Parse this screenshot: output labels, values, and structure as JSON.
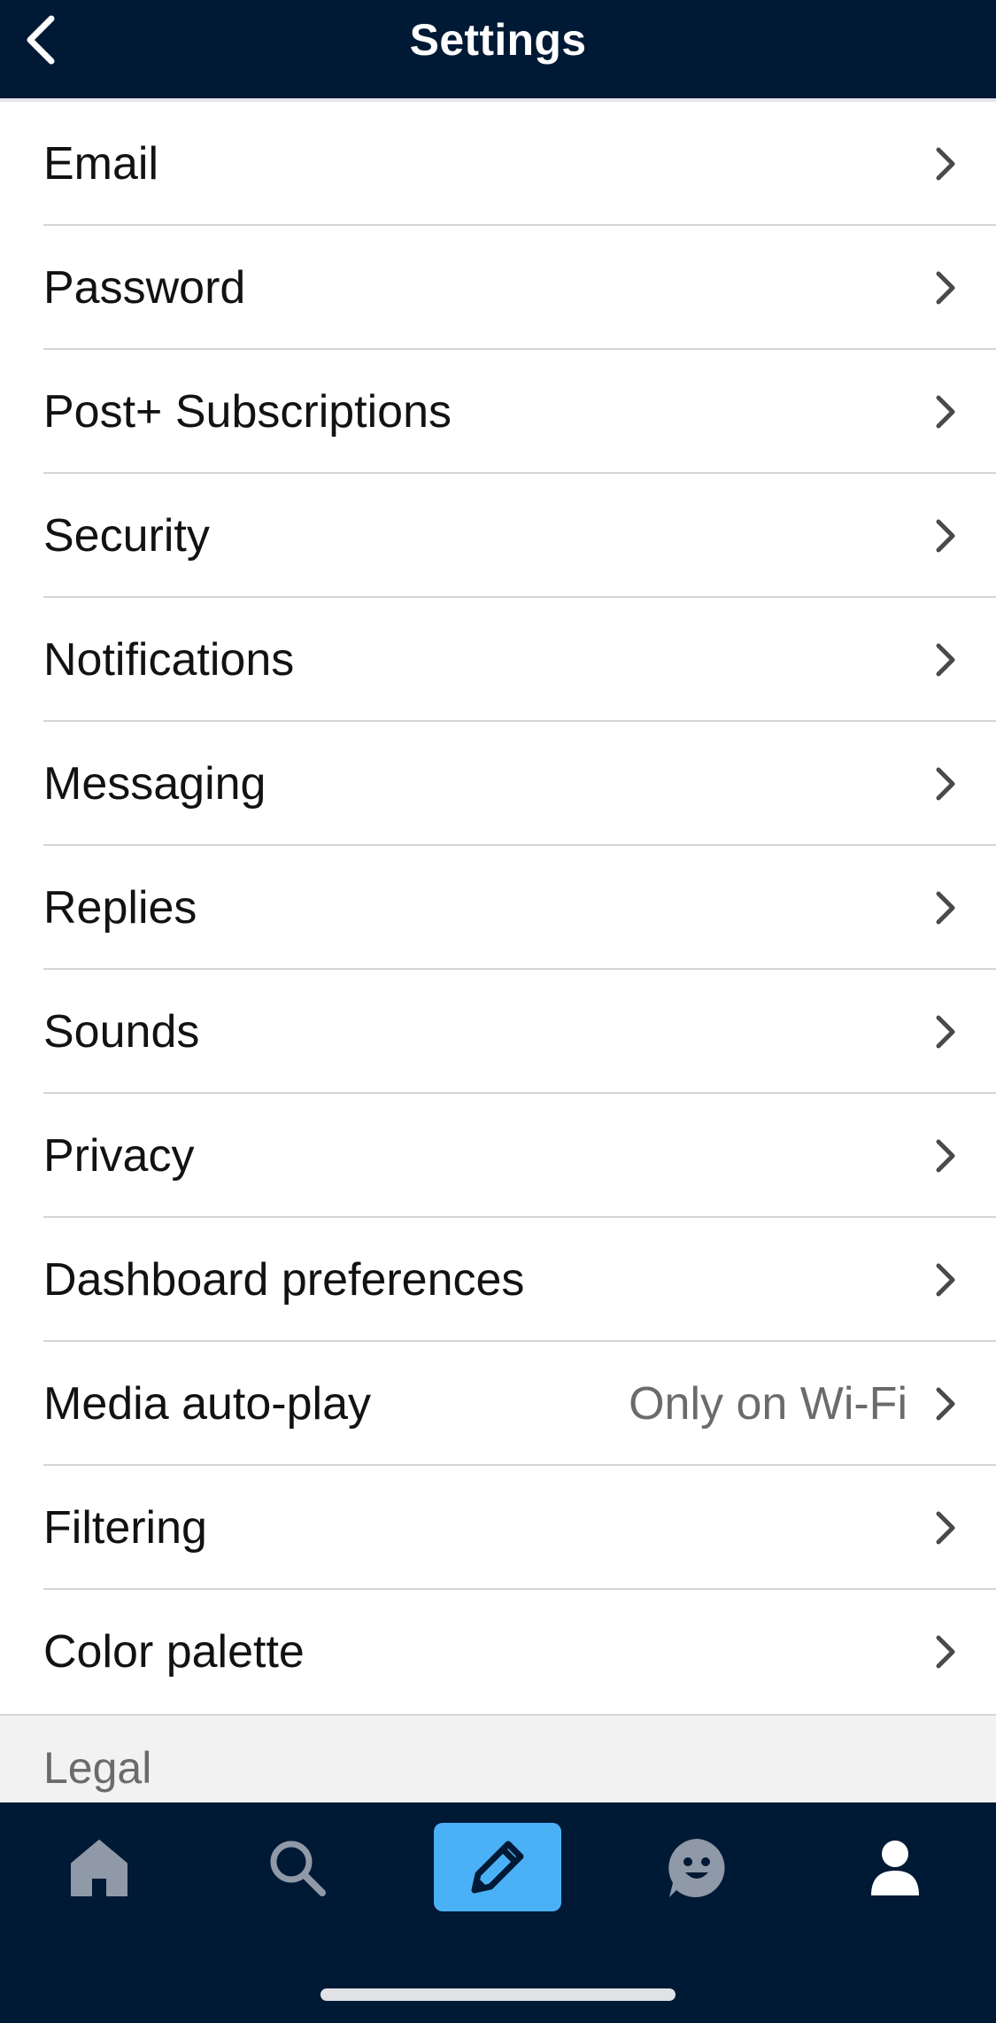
{
  "header": {
    "title": "Settings"
  },
  "settings_items": [
    {
      "label": "Email",
      "value": ""
    },
    {
      "label": "Password",
      "value": ""
    },
    {
      "label": "Post+ Subscriptions",
      "value": ""
    },
    {
      "label": "Security",
      "value": ""
    },
    {
      "label": "Notifications",
      "value": ""
    },
    {
      "label": "Messaging",
      "value": ""
    },
    {
      "label": "Replies",
      "value": ""
    },
    {
      "label": "Sounds",
      "value": ""
    },
    {
      "label": "Privacy",
      "value": ""
    },
    {
      "label": "Dashboard preferences",
      "value": ""
    },
    {
      "label": "Media auto-play",
      "value": "Only on Wi-Fi"
    },
    {
      "label": "Filtering",
      "value": ""
    },
    {
      "label": "Color palette",
      "value": ""
    }
  ],
  "section": {
    "label": "Legal"
  },
  "tab_bar": {
    "tabs": [
      {
        "icon": "home-icon"
      },
      {
        "icon": "search-icon"
      },
      {
        "icon": "pencil-icon"
      },
      {
        "icon": "smiley-icon"
      },
      {
        "icon": "person-icon"
      }
    ]
  },
  "colors": {
    "header_bg": "#001935",
    "compose_accent": "#4bb1f6",
    "text": "#121212",
    "secondary_text": "#6b6b6b"
  }
}
